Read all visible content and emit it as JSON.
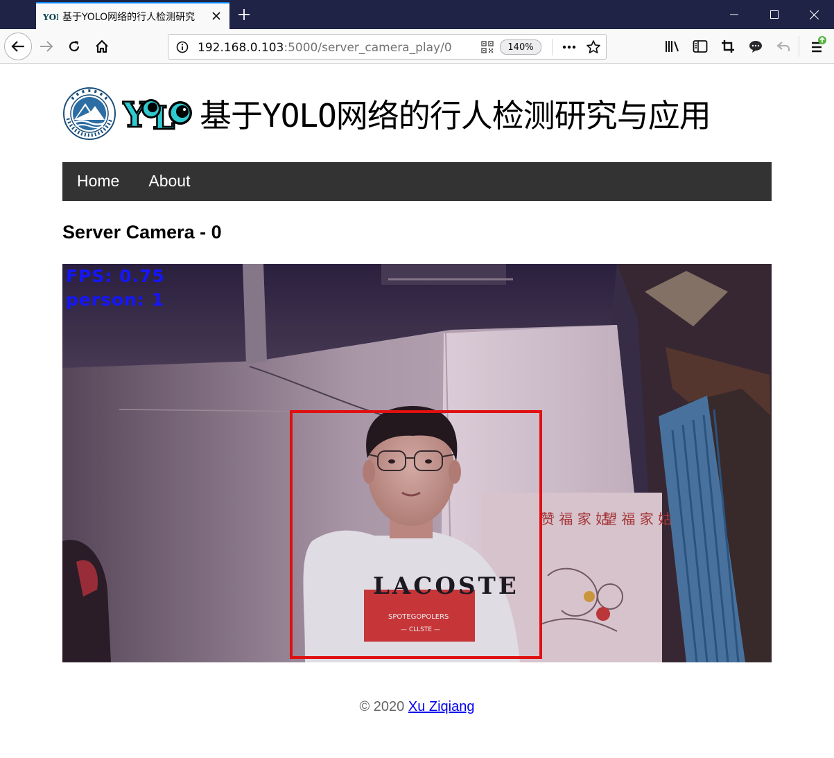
{
  "browser": {
    "tab_title": "基于YOLO网络的行人检测研究",
    "url_host": "192.168.0.103",
    "url_path": ":5000/server_camera_play/0",
    "zoom": "140%"
  },
  "page": {
    "site_title": "基于YOLO网络的行人检测研究与应用",
    "nav": [
      {
        "label": "Home"
      },
      {
        "label": "About"
      }
    ],
    "heading": "Server Camera - 0",
    "overlay": {
      "fps": "FPS: 0.75",
      "person": "person: 1"
    },
    "detection": {
      "label": "person",
      "color": "#e01010"
    },
    "footer": {
      "prefix": "© 2020 ",
      "author": "Xu Ziqiang"
    }
  },
  "colors": {
    "titlebar": "#1f2346",
    "nav_bg": "#333333",
    "accent_tab": "#0a84ff",
    "overlay_text": "#1515ff"
  }
}
